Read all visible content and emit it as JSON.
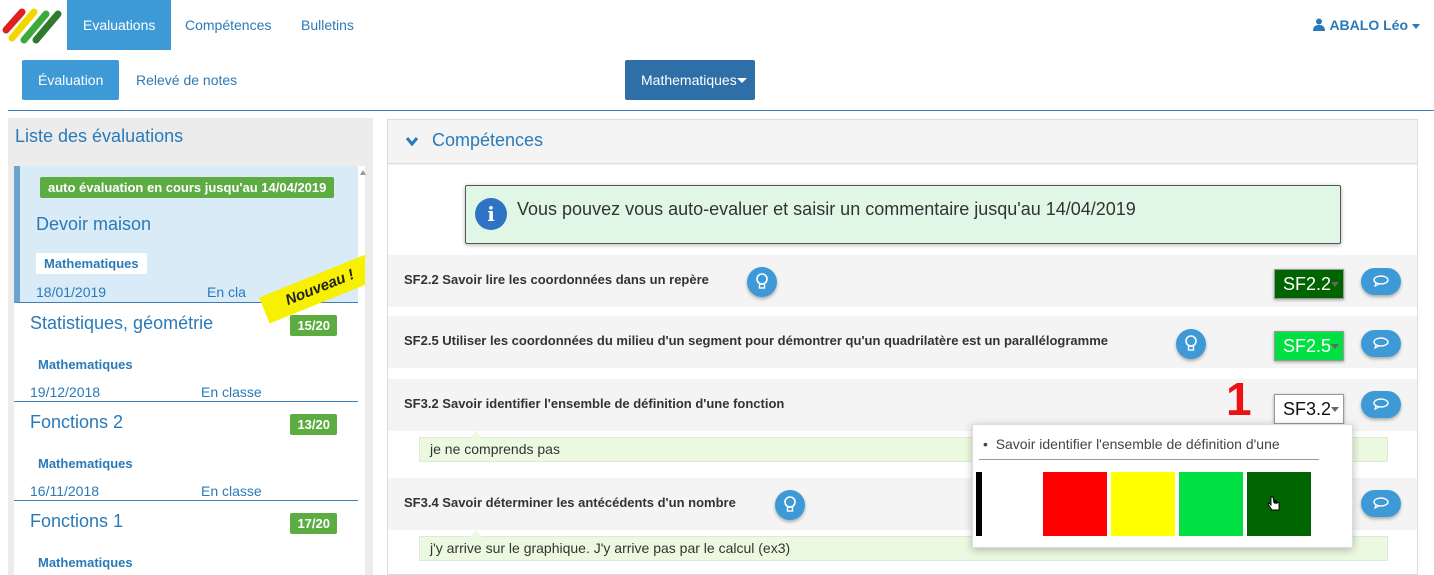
{
  "nav": {
    "tabs": [
      "Evaluations",
      "Compétences",
      "Bulletins"
    ],
    "user": "ABALO Léo"
  },
  "subnav": {
    "tabs": [
      "Évaluation",
      "Relevé de notes"
    ],
    "subject": "Mathematiques"
  },
  "sidebar": {
    "title": "Liste des évaluations",
    "ribbon": "Nouveau !",
    "items": [
      {
        "status": "auto évaluation en cours jusqu'au 14/04/2019",
        "name": "Devoir maison",
        "subject": "Mathematiques",
        "date": "18/01/2019",
        "place": "En cla"
      },
      {
        "name": "Statistiques, géométrie",
        "grade": "15/20",
        "subject": "Mathematiques",
        "date": "19/12/2018",
        "place": "En classe"
      },
      {
        "name": "Fonctions 2",
        "grade": "13/20",
        "subject": "Mathematiques",
        "date": "16/11/2018",
        "place": "En classe"
      },
      {
        "name": "Fonctions 1",
        "grade": "17/20",
        "subject": "Mathematiques"
      }
    ]
  },
  "main": {
    "heading": "Compétences",
    "info": "Vous pouvez vous auto-evaluer et saisir un commentaire jusqu'au 14/04/2019",
    "competences": [
      {
        "label": "SF2.2 Savoir lire les coordonnées dans un repère",
        "code": "SF2.2",
        "level_color": "#006400"
      },
      {
        "label": "SF2.5 Utiliser les coordonnées du milieu d'un segment pour démontrer qu'un quadrilatère est un parallélogramme",
        "code": "SF2.5",
        "level_color": "#00e042"
      },
      {
        "label": "SF3.2 Savoir identifier l'ensemble de définition d'une fonction",
        "code": "SF3.2",
        "level_color": "#ffffff",
        "comment": "je ne comprends pas"
      },
      {
        "label": "SF3.4 Savoir déterminer les antécédents d'un nombre",
        "comment": "j'y arrive sur le graphique. J'y arrive pas par le calcul (ex3)"
      }
    ],
    "annotation": "1",
    "popover": {
      "description": "Savoir identifier l'ensemble de définition d'une",
      "levels": [
        "#000000",
        "#ff0000",
        "#ffff00",
        "#00e042",
        "#006400"
      ]
    }
  }
}
